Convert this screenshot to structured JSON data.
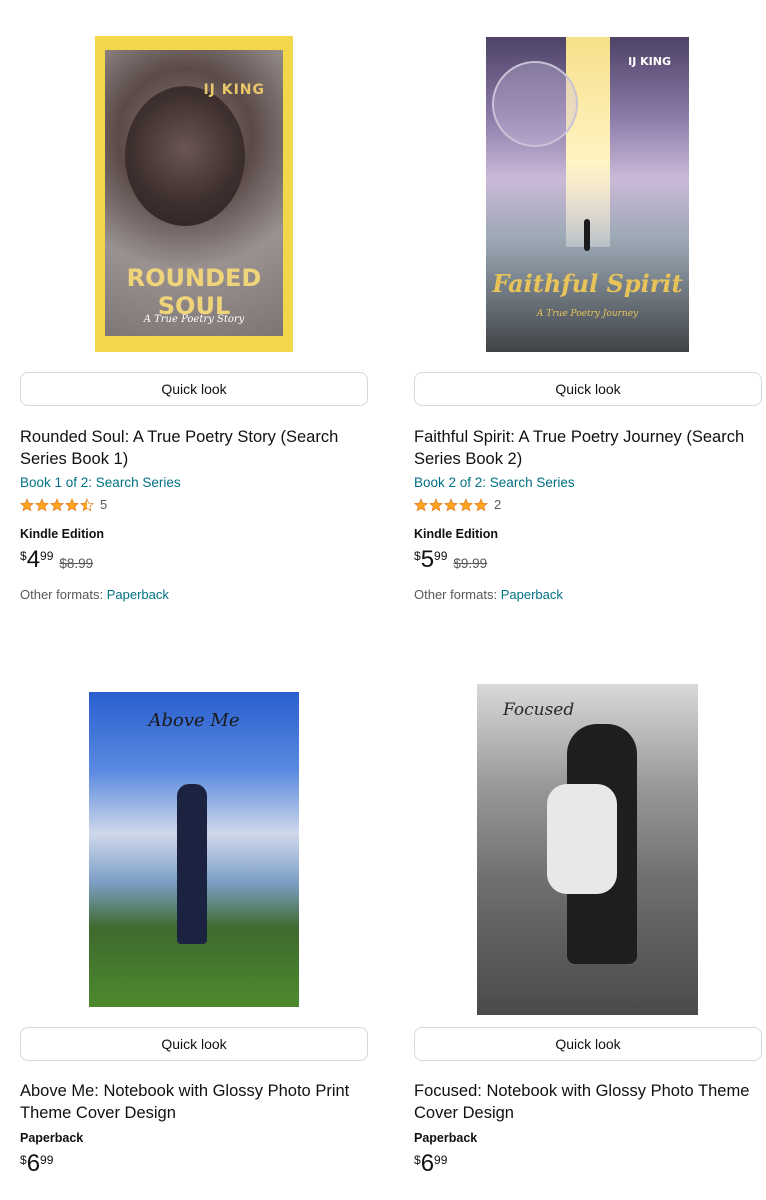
{
  "products": [
    {
      "cover": {
        "author": "IJ KING",
        "title": "ROUNDED SOUL",
        "subtitle": "A True Poetry Story"
      },
      "quick_look": "Quick look",
      "title": "Rounded Soul: A True Poetry Story (Search Series Book 1)",
      "series": "Book 1 of 2: Search Series",
      "rating": {
        "stars": 4.5,
        "count": "5"
      },
      "format": "Kindle Edition",
      "price": {
        "currency": "$",
        "whole": "4",
        "fraction": "99",
        "list": "$8.99"
      },
      "other_formats": {
        "label": "Other formats:",
        "link": "Paperback"
      }
    },
    {
      "cover": {
        "author": "IJ KING",
        "title": "Faithful Spirit",
        "subtitle": "A True Poetry Journey"
      },
      "quick_look": "Quick look",
      "title": "Faithful Spirit: A True Poetry Journey (Search Series Book 2)",
      "series": "Book 2 of 2: Search Series",
      "rating": {
        "stars": 5,
        "count": "2"
      },
      "format": "Kindle Edition",
      "price": {
        "currency": "$",
        "whole": "5",
        "fraction": "99",
        "list": "$9.99"
      },
      "other_formats": {
        "label": "Other formats:",
        "link": "Paperback"
      }
    },
    {
      "cover": {
        "title": "Above Me"
      },
      "quick_look": "Quick look",
      "title": "Above Me: Notebook with Glossy Photo Print Theme Cover Design",
      "format": "Paperback",
      "price": {
        "currency": "$",
        "whole": "6",
        "fraction": "99"
      }
    },
    {
      "cover": {
        "title": "Focused"
      },
      "quick_look": "Quick look",
      "title": "Focused: Notebook with Glossy Photo Theme Cover Design",
      "format": "Paperback",
      "price": {
        "currency": "$",
        "whole": "6",
        "fraction": "99"
      }
    }
  ],
  "colors": {
    "link": "#007185",
    "star": "#ffa41c",
    "border": "#d5d9d9"
  }
}
